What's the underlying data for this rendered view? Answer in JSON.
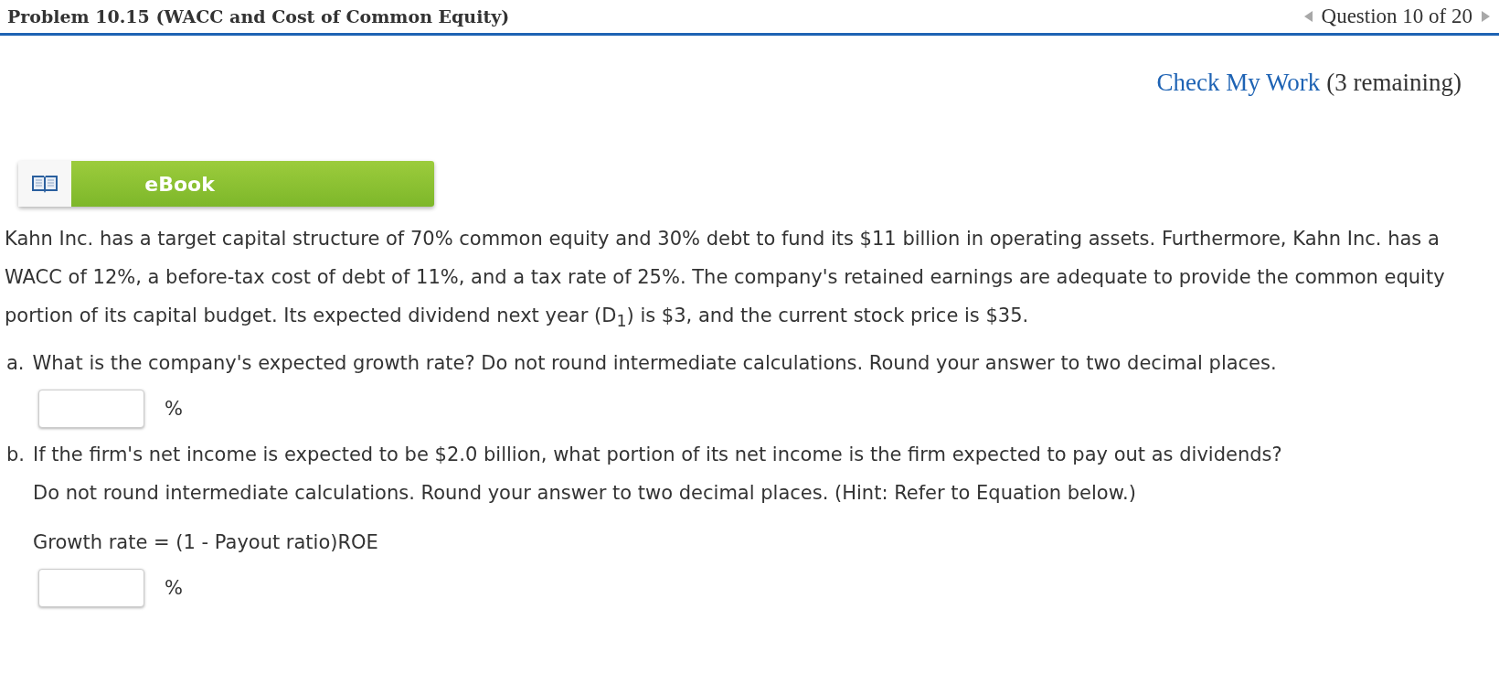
{
  "header": {
    "title": "Problem 10.15 (WACC and Cost of Common Equity)",
    "position": "Question 10 of 20"
  },
  "check": {
    "link": "Check My Work",
    "remaining": "(3 remaining)"
  },
  "ebook": {
    "label": "eBook"
  },
  "problem": "Kahn Inc. has a target capital structure of 70% common equity and 30% debt to fund its $11 billion in operating assets. Furthermore, Kahn Inc. has a WACC of 12%, a before-tax cost of debt of 11%, and a tax rate of 25%. The company's retained earnings are adequate to provide the common equity portion of its capital budget. Its expected dividend next year (D$_{1}$) is $3, and the current stock price is $35.",
  "parts": [
    {
      "letter": "a.",
      "lines": [
        "What is the company's expected growth rate? Do not round intermediate calculations. Round your answer to two decimal places."
      ],
      "unit": "%"
    },
    {
      "letter": "b.",
      "lines": [
        "If the firm's net income is expected to be $2.0 billion, what portion of its net income is the firm expected to pay out as dividends?",
        "Do not round intermediate calculations. Round your answer to two decimal places. (Hint: Refer to Equation below.)",
        "Growth rate = (1 - Payout ratio)ROE"
      ],
      "unit": "%"
    }
  ]
}
